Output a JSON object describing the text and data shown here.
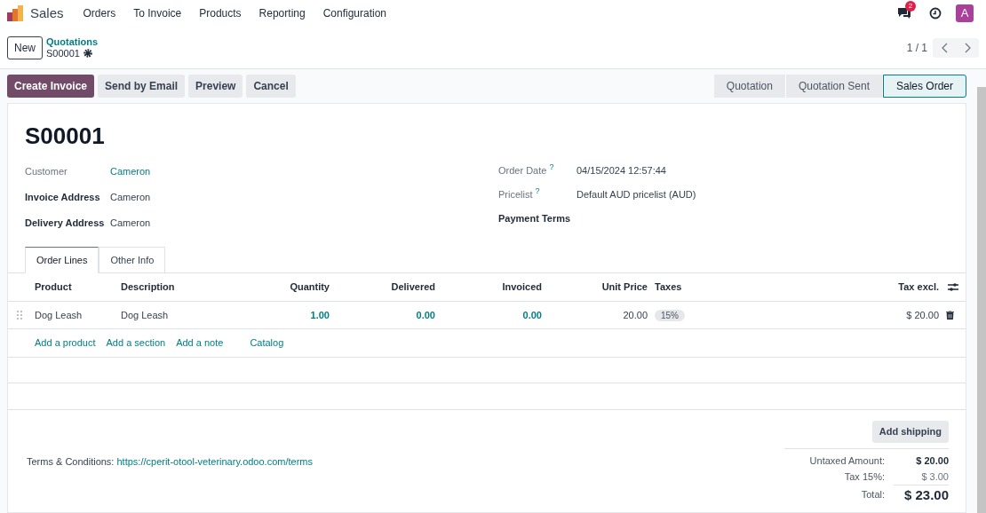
{
  "app": {
    "name": "Sales",
    "menu": [
      "Orders",
      "To Invoice",
      "Products",
      "Reporting",
      "Configuration"
    ],
    "messages_badge": "2",
    "avatar": "A"
  },
  "control_panel": {
    "new_button": "New",
    "breadcrumb": "Quotations",
    "record": "S00001",
    "pager": "1 / 1"
  },
  "actions": [
    {
      "label": "Create Invoice",
      "kind": "primary"
    },
    {
      "label": "Send by Email",
      "kind": "secondary"
    },
    {
      "label": "Preview",
      "kind": "secondary"
    },
    {
      "label": "Cancel",
      "kind": "secondary"
    }
  ],
  "statuses": [
    {
      "label": "Quotation",
      "selected": false
    },
    {
      "label": "Quotation Sent",
      "selected": false
    },
    {
      "label": "Sales Order",
      "selected": true
    }
  ],
  "form": {
    "title": "S00001",
    "left_fields": [
      {
        "label": "Customer",
        "value": "Cameron",
        "kind": "link",
        "bold_label": false
      },
      {
        "label": "Invoice Address",
        "value": "Cameron",
        "kind": "text",
        "bold_label": true
      },
      {
        "label": "Delivery Address",
        "value": "Cameron",
        "kind": "text",
        "bold_label": true
      }
    ],
    "right_fields": [
      {
        "label": "Order Date",
        "help": "?",
        "value": "04/15/2024 12:57:44",
        "bold_label": false
      },
      {
        "label": "Pricelist",
        "help": "?",
        "value": "Default AUD pricelist (AUD)",
        "bold_label": false
      },
      {
        "label": "Payment Terms",
        "bold_label": true
      }
    ]
  },
  "tabs": [
    {
      "label": "Order Lines",
      "selected": true
    },
    {
      "label": "Other Info",
      "selected": false
    }
  ],
  "table": {
    "columns": [
      "Product",
      "Description",
      "Quantity",
      "Delivered",
      "Invoiced",
      "Unit Price",
      "Taxes",
      "Tax excl."
    ],
    "rows": [
      {
        "product": "Dog Leash",
        "description": "Dog Leash",
        "quantity": "1.00",
        "delivered": "0.00",
        "invoiced": "0.00",
        "unit_price": "20.00",
        "tax": "15%",
        "subtotal": "$ 20.00"
      }
    ],
    "add_links": [
      "Add a product",
      "Add a section",
      "Add a note",
      "Catalog"
    ]
  },
  "footer": {
    "add_shipping": "Add shipping",
    "terms_label": "Terms & Conditions:",
    "terms_link": "https://cperit-otool-veterinary.odoo.com/terms",
    "totals": [
      {
        "label": "Untaxed Amount:",
        "value": "$ 20.00",
        "kind": "bold"
      },
      {
        "label": "Tax 15%:",
        "value": "$ 3.00",
        "kind": "plain"
      },
      {
        "label": "Total:",
        "value": "$ 23.00",
        "kind": "grand"
      }
    ]
  }
}
